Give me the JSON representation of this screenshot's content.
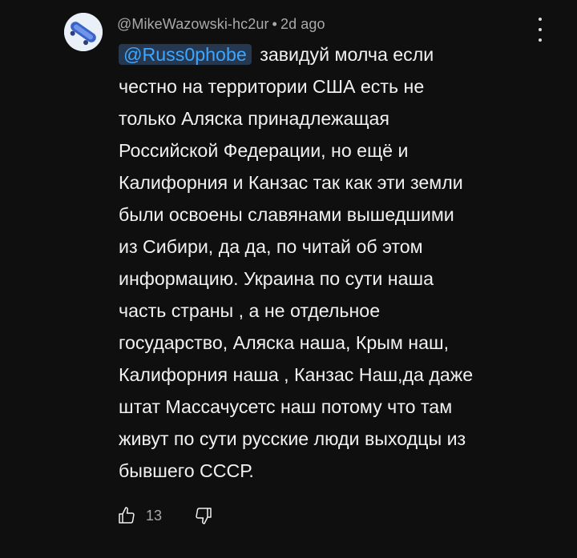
{
  "comment": {
    "author": "@MikeWazowski-hc2ur",
    "separator": "•",
    "time": "2d ago",
    "mention": "@Russ0phobe",
    "text_lines": [
      "завидуй молча если",
      "честно на территории США есть не",
      "только Аляска принадлежащая",
      "Российской Федерации, но ещё и",
      "Калифорния и Канзас так как эти земли",
      "были освоены славянами вышедшими",
      "из Сибири, да да, по читай об этом",
      "информацию. Украина по сути наша",
      "часть страны , а не отдельное",
      "государство, Аляска наша, Крым наш,",
      "Калифорния наша , Канзас Наш,да даже",
      "штат Массачусетс наш потому что там",
      "живут по сути русские люди выходцы из",
      "бывшего СССР."
    ],
    "like_count": "13"
  },
  "icons": {
    "avatar": "avatar-image",
    "menu": "more-vert-icon",
    "like": "thumb-up-icon",
    "dislike": "thumb-down-icon"
  },
  "colors": {
    "background": "#0f0f0f",
    "text": "#f1f1f1",
    "meta": "#aaaaaa",
    "mention_text": "#3ea6ff",
    "mention_bg": "#263850"
  }
}
